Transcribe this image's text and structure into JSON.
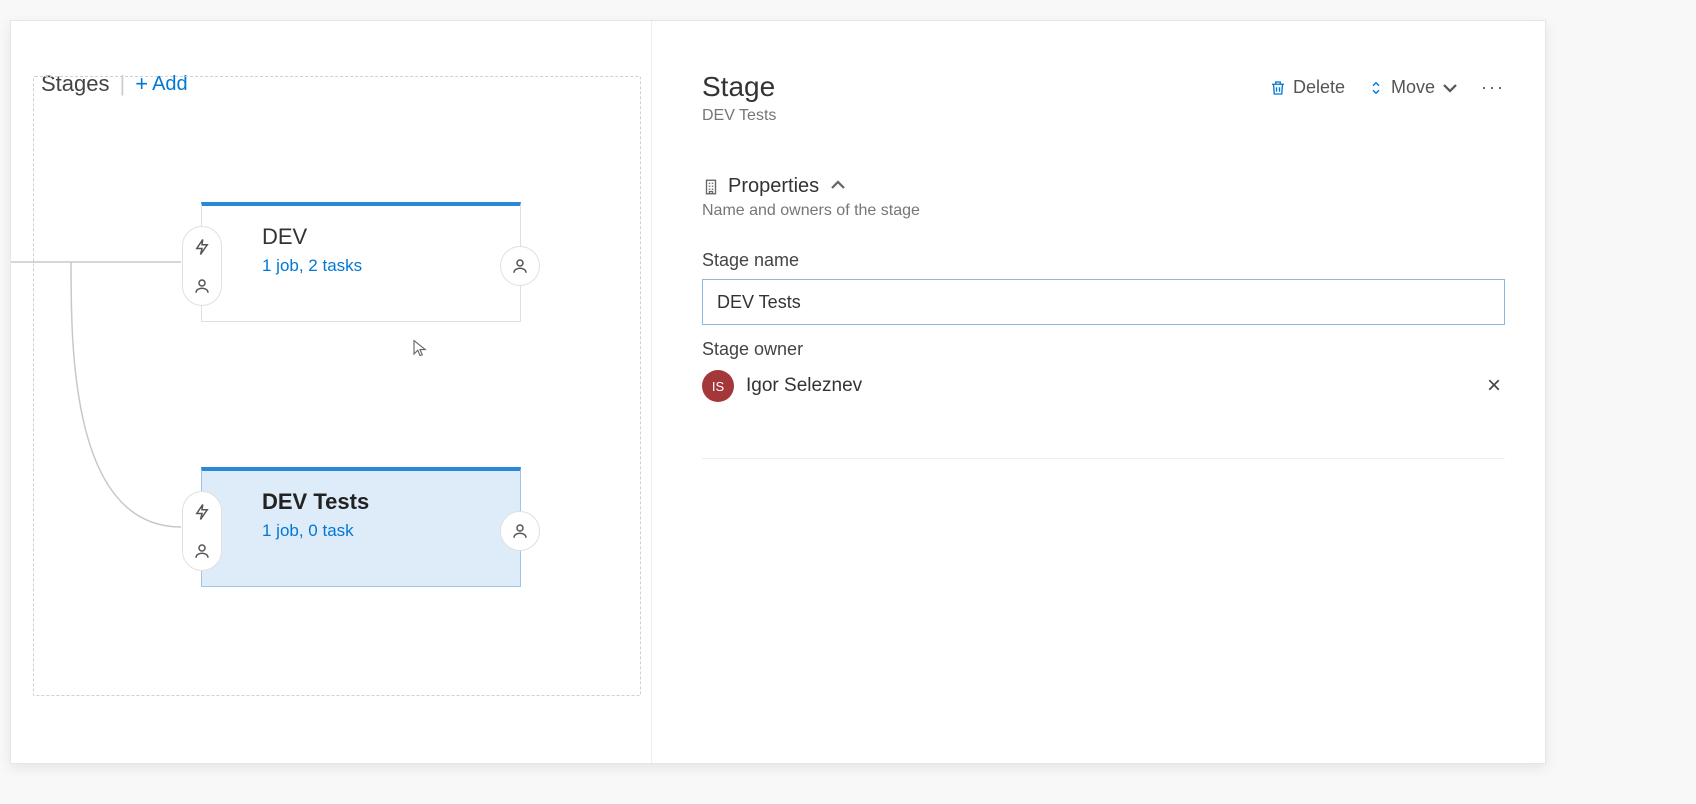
{
  "left": {
    "header_label": "Stages",
    "add_label": "Add"
  },
  "stages": [
    {
      "title": "DEV",
      "subtitle": "1 job, 2 tasks",
      "selected": false
    },
    {
      "title": "DEV Tests",
      "subtitle": "1 job, 0 task",
      "selected": true
    }
  ],
  "right": {
    "panel_title": "Stage",
    "panel_subtitle": "DEV Tests",
    "toolbar": {
      "delete_label": "Delete",
      "move_label": "Move"
    },
    "properties_header": "Properties",
    "properties_desc": "Name and owners of the stage",
    "stage_name_label": "Stage name",
    "stage_name_value": "DEV Tests",
    "stage_owner_label": "Stage owner",
    "owner": {
      "initials": "IS",
      "name": "Igor Seleznev"
    }
  }
}
